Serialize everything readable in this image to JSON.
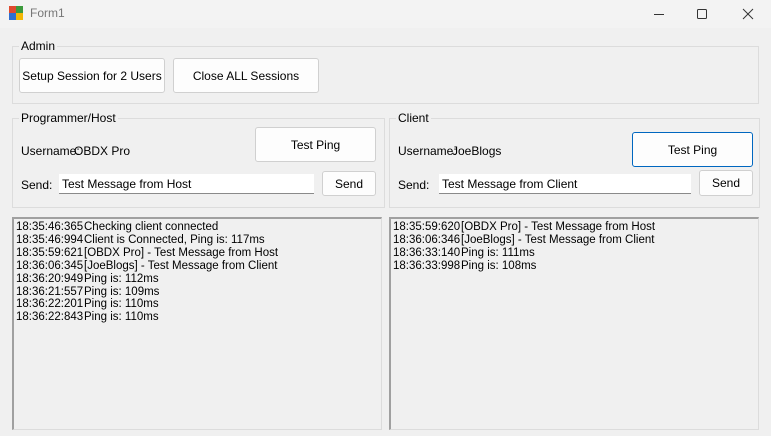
{
  "window": {
    "title": "Form1",
    "icons": {
      "app": "app-icon",
      "minimize": "minimize-icon",
      "maximize": "maximize-icon",
      "close": "close-icon"
    }
  },
  "admin": {
    "legend": "Admin",
    "setup_label": "Setup Session for 2 Users",
    "close_all_label": "Close ALL Sessions"
  },
  "host": {
    "legend": "Programmer/Host",
    "username_label": "Username:",
    "username_value": "OBDX Pro",
    "test_ping_label": "Test Ping",
    "send_label": "Send:",
    "message_value": "Test Message from Host",
    "send_button_label": "Send",
    "log": [
      {
        "time": "18:35:46:365",
        "text": "Checking client connected"
      },
      {
        "time": "18:35:46:994",
        "text": "Client is Connected, Ping is: 117ms"
      },
      {
        "time": "18:35:59:621",
        "text": "[OBDX Pro] - Test Message from Host"
      },
      {
        "time": "18:36:06:345",
        "text": "[JoeBlogs] - Test Message from Client"
      },
      {
        "time": "18:36:20:949",
        "text": "Ping is: 112ms"
      },
      {
        "time": "18:36:21:557",
        "text": "Ping is: 109ms"
      },
      {
        "time": "18:36:22:201",
        "text": "Ping is: 110ms"
      },
      {
        "time": "18:36:22:843",
        "text": "Ping is: 110ms"
      }
    ]
  },
  "client": {
    "legend": "Client",
    "username_label": "Username:",
    "username_value": "JoeBlogs",
    "test_ping_label": "Test Ping",
    "send_label": "Send:",
    "message_value": "Test Message from Client",
    "send_button_label": "Send",
    "log": [
      {
        "time": "18:35:59:620",
        "text": "[OBDX Pro] - Test Message from Host"
      },
      {
        "time": "18:36:06:346",
        "text": "[JoeBlogs] - Test Message from Client"
      },
      {
        "time": "18:36:33:140",
        "text": "Ping is: 111ms"
      },
      {
        "time": "18:36:33:998",
        "text": "Ping is: 108ms"
      }
    ]
  },
  "colors": {
    "background": "#f0f0f0",
    "focus_border": "#0067c0"
  }
}
